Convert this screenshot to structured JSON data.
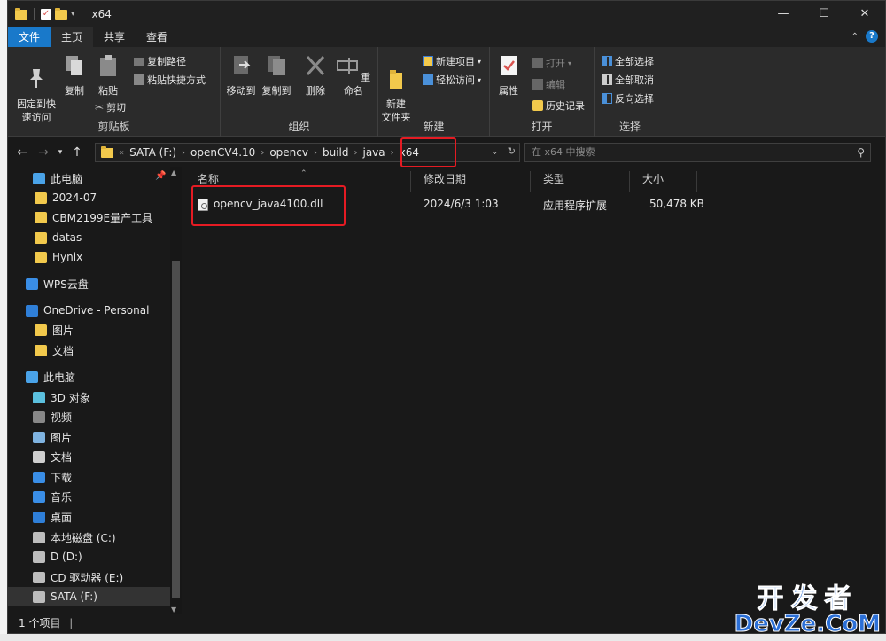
{
  "window": {
    "title": "x64",
    "min": "—",
    "max": "☐",
    "close": "✕"
  },
  "tabs": [
    "文件",
    "主页",
    "共享",
    "查看"
  ],
  "ribbon": {
    "clipboard": {
      "label": "剪贴板",
      "pin": "固定到快\n速访问",
      "copy": "复制",
      "paste": "粘贴",
      "copy_path": "复制路径",
      "paste_shortcut": "粘贴快捷方式",
      "cut": "剪切"
    },
    "organize": {
      "label": "组织",
      "move_to": "移动到",
      "copy_to": "复制到",
      "delete": "删除",
      "rename": "重命名"
    },
    "new": {
      "label": "新建",
      "new_folder": "新建\n文件夹",
      "new_item": "新建项目",
      "easy_access": "轻松访问"
    },
    "open": {
      "label": "打开",
      "properties": "属性",
      "open": "打开",
      "edit": "编辑",
      "history": "历史记录"
    },
    "select": {
      "label": "选择",
      "select_all": "全部选择",
      "select_none": "全部取消",
      "invert": "反向选择"
    }
  },
  "address": {
    "crumbs": [
      "SATA (F:)",
      "openCV4.10",
      "opencv",
      "build",
      "java",
      "x64"
    ],
    "search_placeholder": "在 x64 中搜索"
  },
  "sidebar": {
    "items": [
      {
        "label": "此电脑",
        "icon": "computer-icon"
      },
      {
        "label": "2024-07",
        "icon": "folder-icon"
      },
      {
        "label": "CBM2199E量产工具",
        "icon": "folder-icon"
      },
      {
        "label": "datas",
        "icon": "folder-icon"
      },
      {
        "label": "Hynix",
        "icon": "folder-icon"
      },
      {
        "label": "WPS云盘",
        "icon": "cloud-icon"
      },
      {
        "label": "OneDrive - Personal",
        "icon": "onedrive-icon"
      },
      {
        "label": "图片",
        "icon": "folder-icon"
      },
      {
        "label": "文档",
        "icon": "folder-icon"
      },
      {
        "label": "此电脑",
        "icon": "computer-icon"
      },
      {
        "label": "3D 对象",
        "icon": "cube-icon"
      },
      {
        "label": "视频",
        "icon": "video-icon"
      },
      {
        "label": "图片",
        "icon": "picture-icon"
      },
      {
        "label": "文档",
        "icon": "document-icon"
      },
      {
        "label": "下载",
        "icon": "download-icon"
      },
      {
        "label": "音乐",
        "icon": "music-icon"
      },
      {
        "label": "桌面",
        "icon": "desktop-icon"
      },
      {
        "label": "本地磁盘 (C:)",
        "icon": "drive-icon"
      },
      {
        "label": "D (D:)",
        "icon": "drive-icon"
      },
      {
        "label": "CD 驱动器 (E:)",
        "icon": "cd-drive-icon"
      },
      {
        "label": "SATA (F:)",
        "icon": "drive-icon"
      }
    ]
  },
  "columns": [
    "名称",
    "修改日期",
    "类型",
    "大小"
  ],
  "files": [
    {
      "name": "opencv_java4100.dll",
      "modified": "2024/6/3 1:03",
      "type": "应用程序扩展",
      "size": "50,478 KB"
    }
  ],
  "status": {
    "count": "1 个项目"
  },
  "watermark": {
    "line1": "开发者",
    "line2": "DevZe.CoM"
  },
  "colors": {
    "accent": "#1979ca",
    "highlight": "#e51b23",
    "folder": "#f2c94c"
  }
}
